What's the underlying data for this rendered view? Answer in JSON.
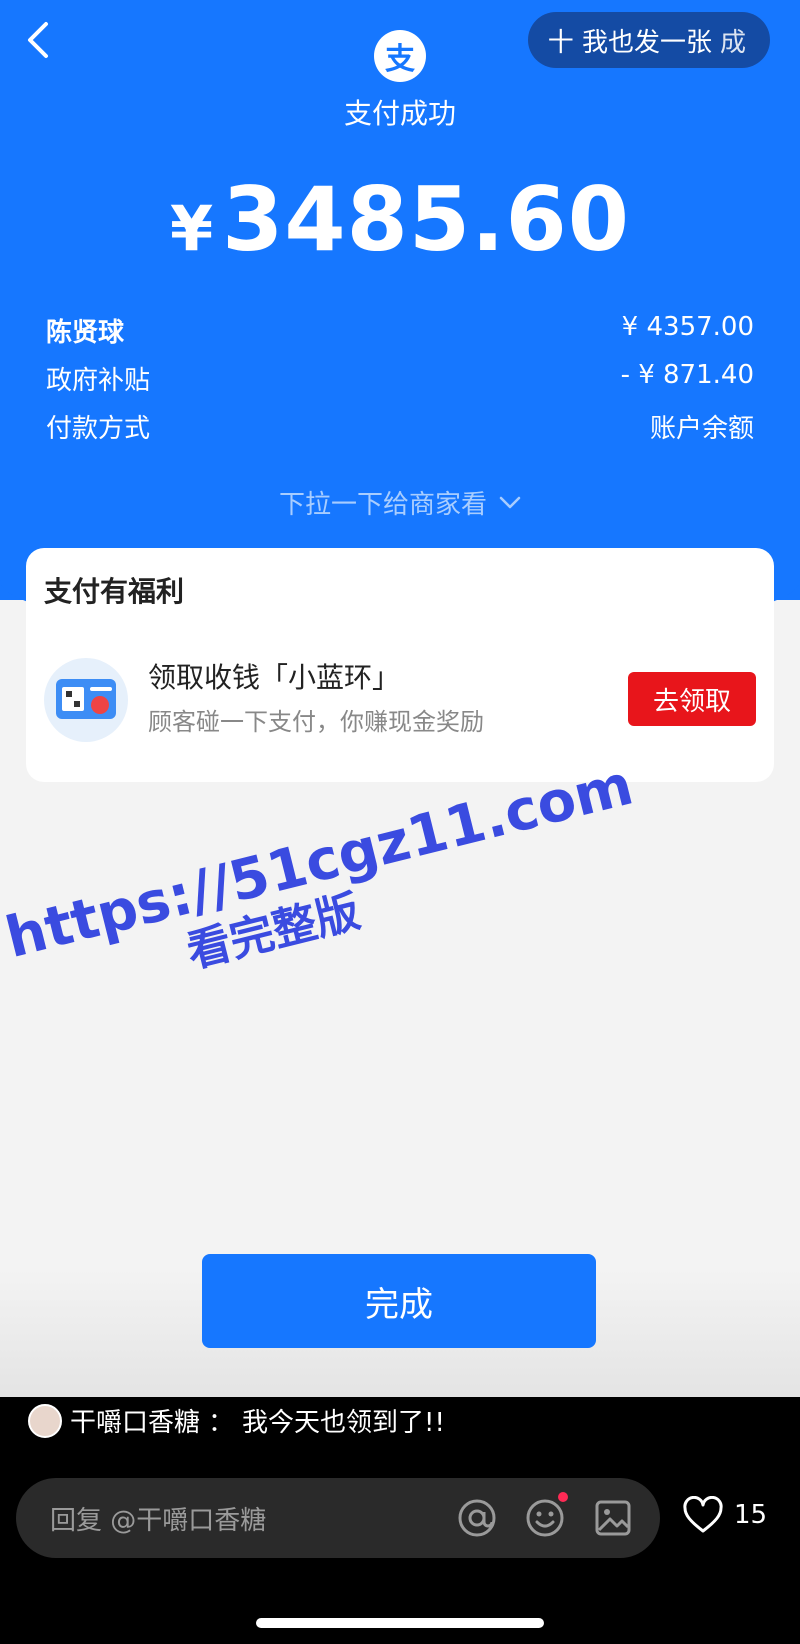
{
  "header": {
    "back_icon": "chevron-left-icon",
    "share_label": "十 我也发一张",
    "share_suffix": "成",
    "logo_char": "支",
    "status_title": "支付成功"
  },
  "amount": {
    "currency": "¥",
    "value": "3485.60"
  },
  "details": [
    {
      "label": "陈贤球",
      "value": "¥ 4357.00"
    },
    {
      "label": "政府补贴",
      "value": "- ¥ 871.40"
    },
    {
      "label": "付款方式",
      "value": "账户余额"
    }
  ],
  "pull_hint": "下拉一下给商家看",
  "benefit_card": {
    "title": "支付有福利",
    "promo_title": "领取收钱「小蓝环」",
    "promo_subtitle": "顾客碰一下支付，你赚现金奖励",
    "claim_label": "去领取"
  },
  "watermark": {
    "url": "https://51cgz11.com",
    "text": "看完整版"
  },
  "done_label": "完成",
  "comment": {
    "user": "干嚼口香糖",
    "separator": "：",
    "text": "我今天也领到了!!"
  },
  "reply": {
    "placeholder": "回复 @干嚼口香糖"
  },
  "likes": "15",
  "colors": {
    "primary_blue": "#1677ff",
    "claim_red": "#e8151b",
    "watermark": "#3a4be0"
  }
}
